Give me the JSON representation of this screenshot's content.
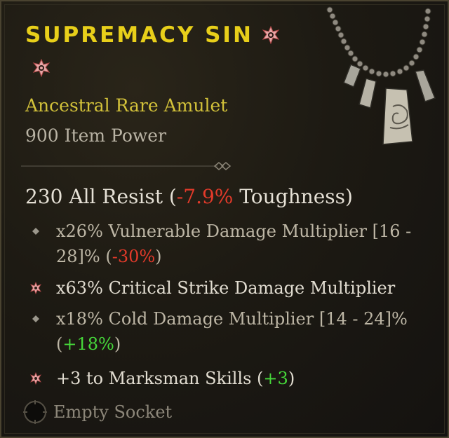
{
  "item": {
    "name": "SUPREMACY SIN",
    "type": "Ancestral Rare Amulet",
    "power": "900 Item Power"
  },
  "base_stat": {
    "value": "230 All Resist (",
    "delta": "-7.9%",
    "suffix": " Toughness)"
  },
  "affixes": [
    {
      "part1": "x26% Vulnerable Damage Multiplier [16 - 28]% (",
      "delta": "-30%",
      "part2": ")",
      "bullet": "diamond-icon"
    },
    {
      "text": "x63% Critical Strike Damage Multiplier",
      "bullet": "greater-affix-icon"
    },
    {
      "part1": "x18% Cold Damage Multiplier [14 - 24]% (",
      "delta": "+18%",
      "part2": ")",
      "bullet": "diamond-icon"
    },
    {
      "part1": "+3 to Marksman Skills (",
      "delta": "+3",
      "part2": ")",
      "bullet": "greater-affix-icon"
    }
  ],
  "socket": "Empty Socket",
  "colors": {
    "title": "#e8cf1a",
    "rarity": "#d3c23a",
    "negative": "#e23a2a",
    "positive": "#46d83a"
  }
}
